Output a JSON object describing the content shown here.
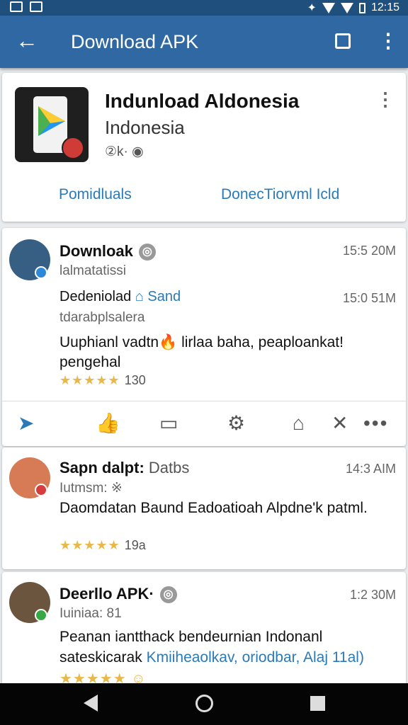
{
  "status_bar": {
    "time": "12:15"
  },
  "app_bar": {
    "title": "Download APK"
  },
  "app_card": {
    "name": "Indunload Aldonesia",
    "subtitle": "Indonesia",
    "meta": "②k·",
    "link_left": "Pomidluals",
    "link_right": "DonecTiorvml Icld"
  },
  "post": {
    "author": "Downloak",
    "author_handle": "lalmatatissi",
    "time1": "15:5 20M",
    "line2_left": "Dedeniolad",
    "line2_right": "Sand",
    "line2_time": "15:0 51M",
    "line2_sub": "tdarabplsalera",
    "body": "Uuphianl vadtn🔥 lirlaa baha, peaploankat! pengehal",
    "rating_count": "130"
  },
  "comments": [
    {
      "author": "Sapn dalpt:",
      "author_suffix": "Datbs",
      "handle": "Iutmsm: ※",
      "time": "14:3 AIM",
      "body": "Daomdatan Baund Eadoatioah Alpdne'k patml.",
      "rating_count": "19a"
    },
    {
      "author": "Deerllo APK·",
      "handle": "Iuiniaa: 81",
      "time": "1:2 30M",
      "body_line1": "Peanan iantthack bendeurnian Indonanl",
      "body_line2_dark": "sateskicarak",
      "body_line2_link": "Kmiiheaolkav, oriodbar, Alaj 11al)"
    }
  ],
  "colors": {
    "header": "#2f68a3",
    "status": "#1f4f7d",
    "link": "#2a7ab8",
    "star": "#e8b84a"
  },
  "icons": [
    "back-arrow-icon",
    "square-icon",
    "more-icon",
    "like-icon",
    "comment-icon",
    "settings-icon",
    "bookmark-icon",
    "close-icon",
    "home-icon",
    "recent-icon"
  ]
}
